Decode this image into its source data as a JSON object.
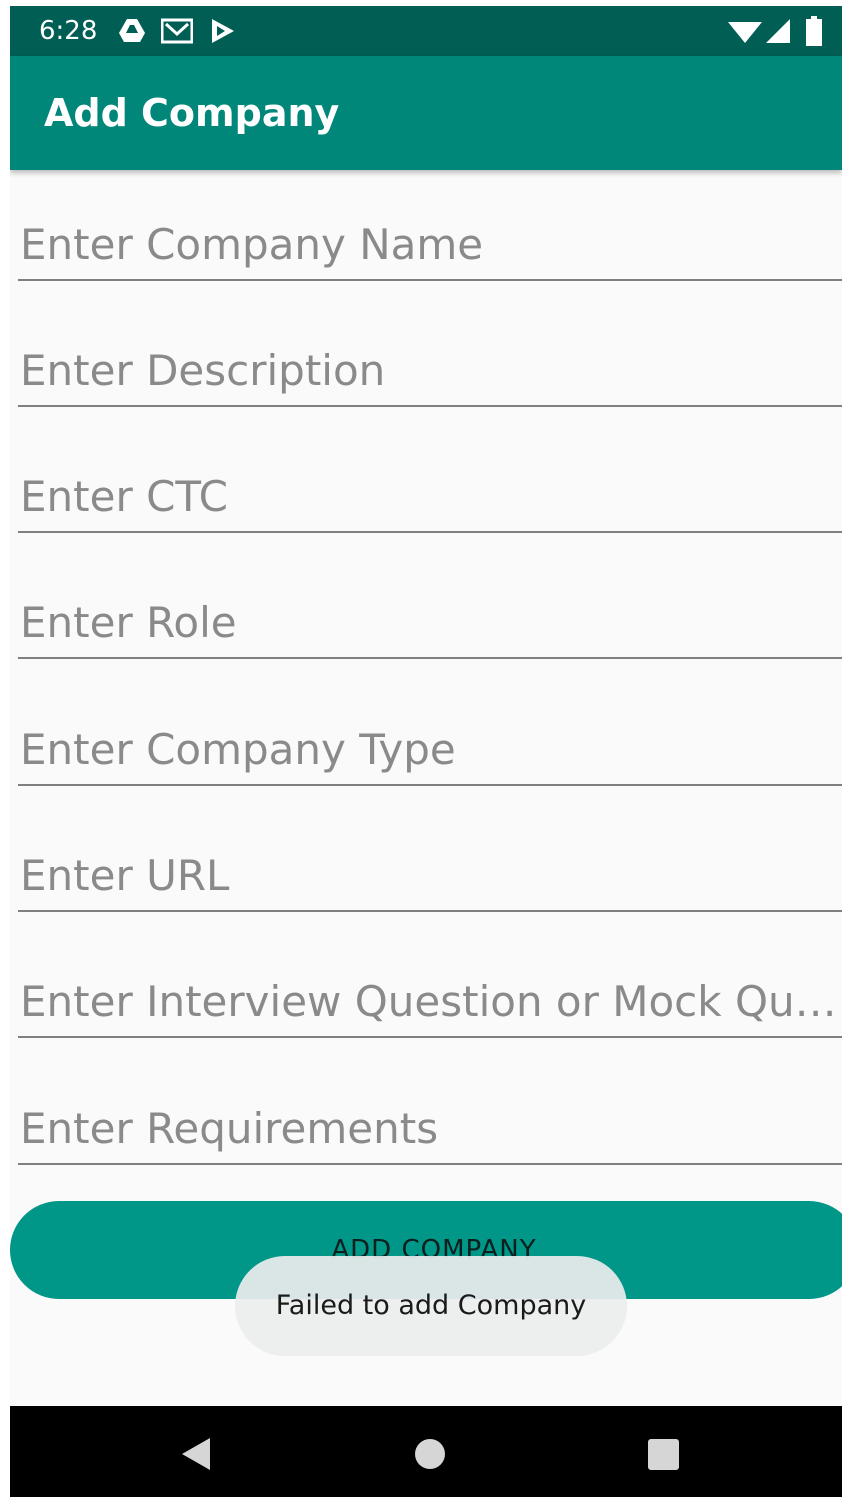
{
  "status_bar": {
    "time": "6:28",
    "left_icons": [
      "drive-icon",
      "gmail-icon",
      "play-store-icon"
    ],
    "right_icons": [
      "wifi-icon",
      "signal-icon",
      "battery-icon"
    ]
  },
  "app_bar": {
    "title": "Add Company"
  },
  "form": {
    "fields": [
      {
        "name": "company-name-input",
        "value": "",
        "placeholder": "Enter Company Name"
      },
      {
        "name": "description-input",
        "value": "",
        "placeholder": "Enter Description"
      },
      {
        "name": "ctc-input",
        "value": "",
        "placeholder": "Enter CTC"
      },
      {
        "name": "role-input",
        "value": "",
        "placeholder": "Enter Role"
      },
      {
        "name": "company-type-input",
        "value": "",
        "placeholder": "Enter Company Type"
      },
      {
        "name": "url-input",
        "value": "",
        "placeholder": "Enter URL"
      },
      {
        "name": "interview-question-input",
        "value": "",
        "placeholder": "Enter Interview Question or Mock Quest…"
      },
      {
        "name": "requirements-input",
        "value": "",
        "placeholder": "Enter Requirements"
      }
    ],
    "submit_label": "ADD COMPANY"
  },
  "toast": {
    "message": "Failed to add Company"
  },
  "nav_bar": {
    "buttons": [
      "back-icon",
      "home-icon",
      "recents-icon"
    ]
  },
  "colors": {
    "status_bar": "#005e54",
    "app_bar": "#00877a",
    "button": "#009688",
    "background": "#fafafa"
  }
}
